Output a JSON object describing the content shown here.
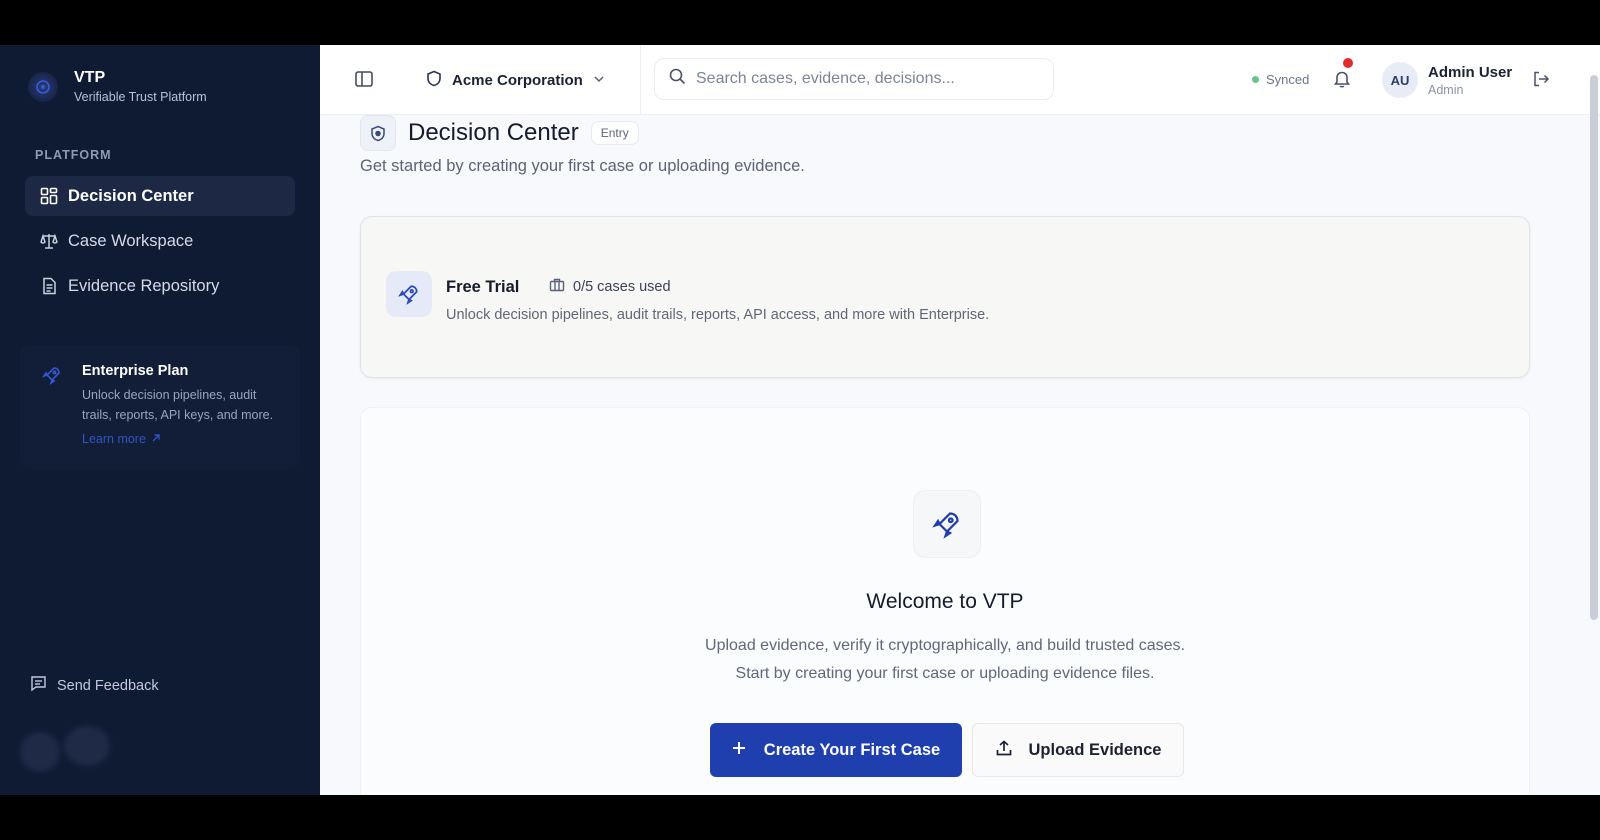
{
  "brand": {
    "title": "VTP",
    "subtitle": "Verifiable Trust Platform",
    "logo_icon": "vtp-logo-icon"
  },
  "sidebar": {
    "section_label": "PLATFORM",
    "items": [
      {
        "label": "Decision Center",
        "icon": "dashboard-grid-icon",
        "active": true
      },
      {
        "label": "Case Workspace",
        "icon": "scale-icon",
        "active": false
      },
      {
        "label": "Evidence Repository",
        "icon": "document-icon",
        "active": false
      }
    ],
    "promo": {
      "title": "Enterprise Plan",
      "text": "Unlock decision pipelines, audit trails, reports, API keys, and more.",
      "link": "Learn more",
      "icon": "rocket-icon"
    },
    "feedback": {
      "label": "Send Feedback",
      "icon": "message-square-icon"
    }
  },
  "topbar": {
    "org_name": "Acme Corporation",
    "search_placeholder": "Search cases, evidence, decisions...",
    "sync_status": "Synced",
    "user": {
      "initials": "AU",
      "name": "Admin User",
      "role": "Admin"
    }
  },
  "page": {
    "title": "Decision Center",
    "badge": "Entry",
    "subtitle": "Get started by creating your first case or uploading evidence."
  },
  "trial": {
    "title": "Free Trial",
    "usage": "0/5 cases used",
    "description": "Unlock decision pipelines, audit trails, reports, API access, and more with Enterprise."
  },
  "welcome": {
    "title": "Welcome to VTP",
    "line1": "Upload evidence, verify it cryptographically, and build trusted cases.",
    "line2": "Start by creating your first case or uploading evidence files.",
    "primary_button": "Create Your First Case",
    "secondary_button": "Upload Evidence"
  },
  "colors": {
    "sidebar_bg": "#0f1a33",
    "accent": "#1f3fae",
    "notification": "#e32b2b",
    "synced": "#67c48a"
  }
}
